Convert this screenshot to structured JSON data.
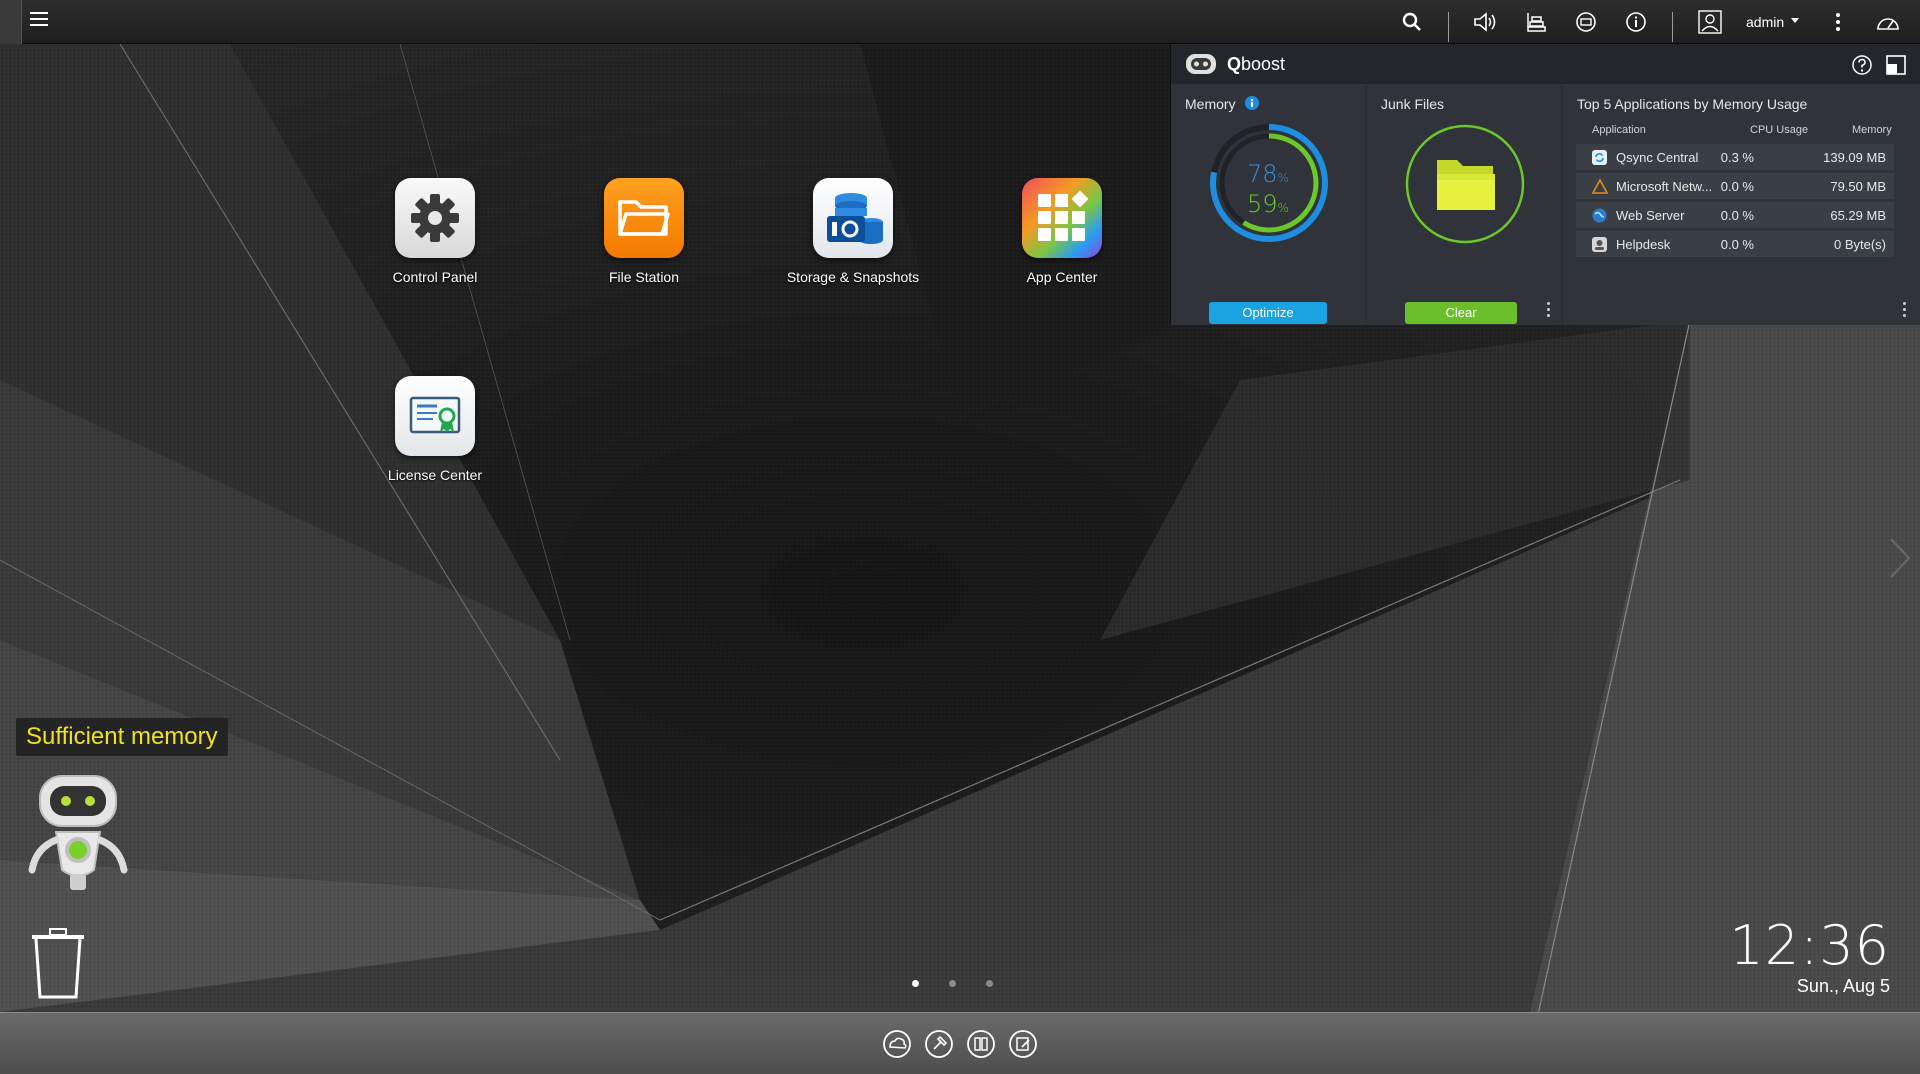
{
  "topbar": {
    "user": "admin"
  },
  "desktop": {
    "apps": [
      {
        "label": "Control Panel"
      },
      {
        "label": "File Station"
      },
      {
        "label": "Storage & Snapshots"
      },
      {
        "label": "App Center"
      },
      {
        "label": "License Center"
      }
    ],
    "pager": {
      "count": 3,
      "active": 1
    },
    "status_text": "Sufficient memory",
    "clock": {
      "time": "12:36",
      "date": "Sun., Aug 5"
    }
  },
  "qboost": {
    "title_bold": "Q",
    "title_rest": "boost",
    "memory": {
      "label": "Memory",
      "outer_percent": 78,
      "inner_percent": 59,
      "outer_text": "78",
      "inner_text": "59",
      "unit": "%",
      "button": "Optimize"
    },
    "junk": {
      "label": "Junk Files",
      "button": "Clear"
    },
    "top_apps": {
      "title": "Top 5 Applications by Memory Usage",
      "headers": {
        "app": "Application",
        "cpu": "CPU Usage",
        "mem": "Memory"
      },
      "rows": [
        {
          "name": "Qsync Central",
          "cpu": "0.3 %",
          "mem": "139.09 MB",
          "icon": "qsync-icon"
        },
        {
          "name": "Microsoft Netw...",
          "cpu": "0.0 %",
          "mem": "79.50 MB",
          "icon": "microsoft-networking-icon"
        },
        {
          "name": "Web Server",
          "cpu": "0.0 %",
          "mem": "65.29 MB",
          "icon": "web-server-icon"
        },
        {
          "name": "Helpdesk",
          "cpu": "0.0 %",
          "mem": "0 Byte(s)",
          "icon": "helpdesk-icon"
        }
      ]
    }
  },
  "colors": {
    "memory_blue": "#1e8fe0",
    "memory_green": "#6cc72a",
    "optimize_button": "#1aa3e0",
    "clear_button": "#6bbf2a",
    "status_yellow": "#f0e31b"
  }
}
